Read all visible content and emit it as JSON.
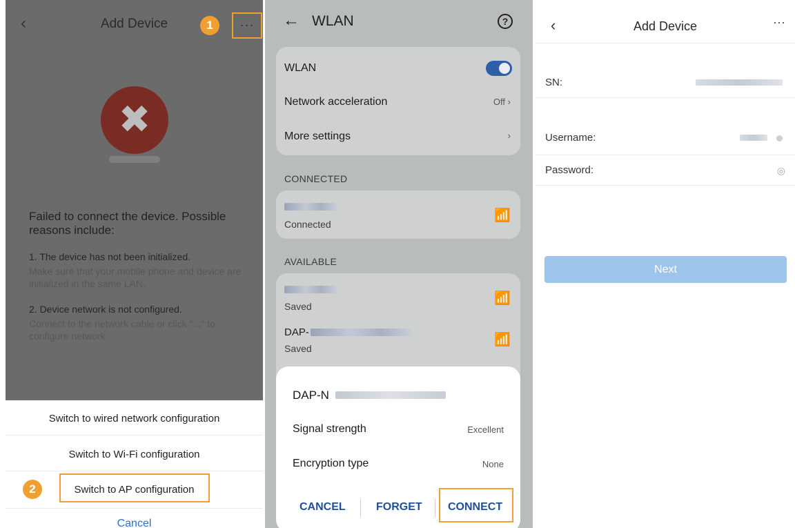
{
  "panel1": {
    "title": "Add Device",
    "back_icon": "chevron-left-icon",
    "more_label": "···",
    "step1": "1",
    "step2": "2",
    "error_message": "Failed to connect the device. Possible reasons include:",
    "reasons": [
      {
        "heading": "1. The device has not been initialized.",
        "detail": "Make sure that your mobile phone and device are initialized in the same LAN."
      },
      {
        "heading": "2. Device network is not configured.",
        "detail": "Connect to the network cable or click \"...\" to configure network."
      }
    ],
    "options": [
      "Switch to wired network configuration",
      "Switch to Wi-Fi configuration",
      "Switch to AP configuration"
    ],
    "cancel_label": "Cancel",
    "colors": {
      "step_badge": "#f0a030",
      "highlight_border": "#f0a030",
      "error_icon": "#7a2c24"
    }
  },
  "panel2": {
    "title": "WLAN",
    "back_icon": "arrow-left-icon",
    "help_icon": "question-circle-icon",
    "help_glyph": "?",
    "settings": [
      {
        "label": "WLAN",
        "toggle": true
      },
      {
        "label": "Network acceleration",
        "value": "Off"
      },
      {
        "label": "More settings"
      }
    ],
    "connected_header": "CONNECTED",
    "connected_status": "Connected",
    "available_header": "AVAILABLE",
    "available": [
      {
        "ssid": "",
        "status": "Saved"
      },
      {
        "ssid": "DAP-",
        "status": "Saved"
      }
    ],
    "dialog": {
      "ssid": "DAP-N",
      "signal_label": "Signal strength",
      "signal_value": "Excellent",
      "encryption_label": "Encryption type",
      "encryption_value": "None",
      "cancel_label": "CANCEL",
      "forget_label": "FORGET",
      "connect_label": "CONNECT"
    },
    "colors": {
      "toggle_on": "#2f5fa8",
      "button_text": "#1d4e9e"
    }
  },
  "panel3": {
    "title": "Add Device",
    "back_icon": "chevron-left-icon",
    "more_label": "···",
    "sn_label": "SN:",
    "sn_value": "",
    "username_label": "Username:",
    "password_label": "Password:",
    "password_icon": "eye-off-icon",
    "next_label": "Next",
    "colors": {
      "next_button": "#9dc4ea"
    }
  }
}
